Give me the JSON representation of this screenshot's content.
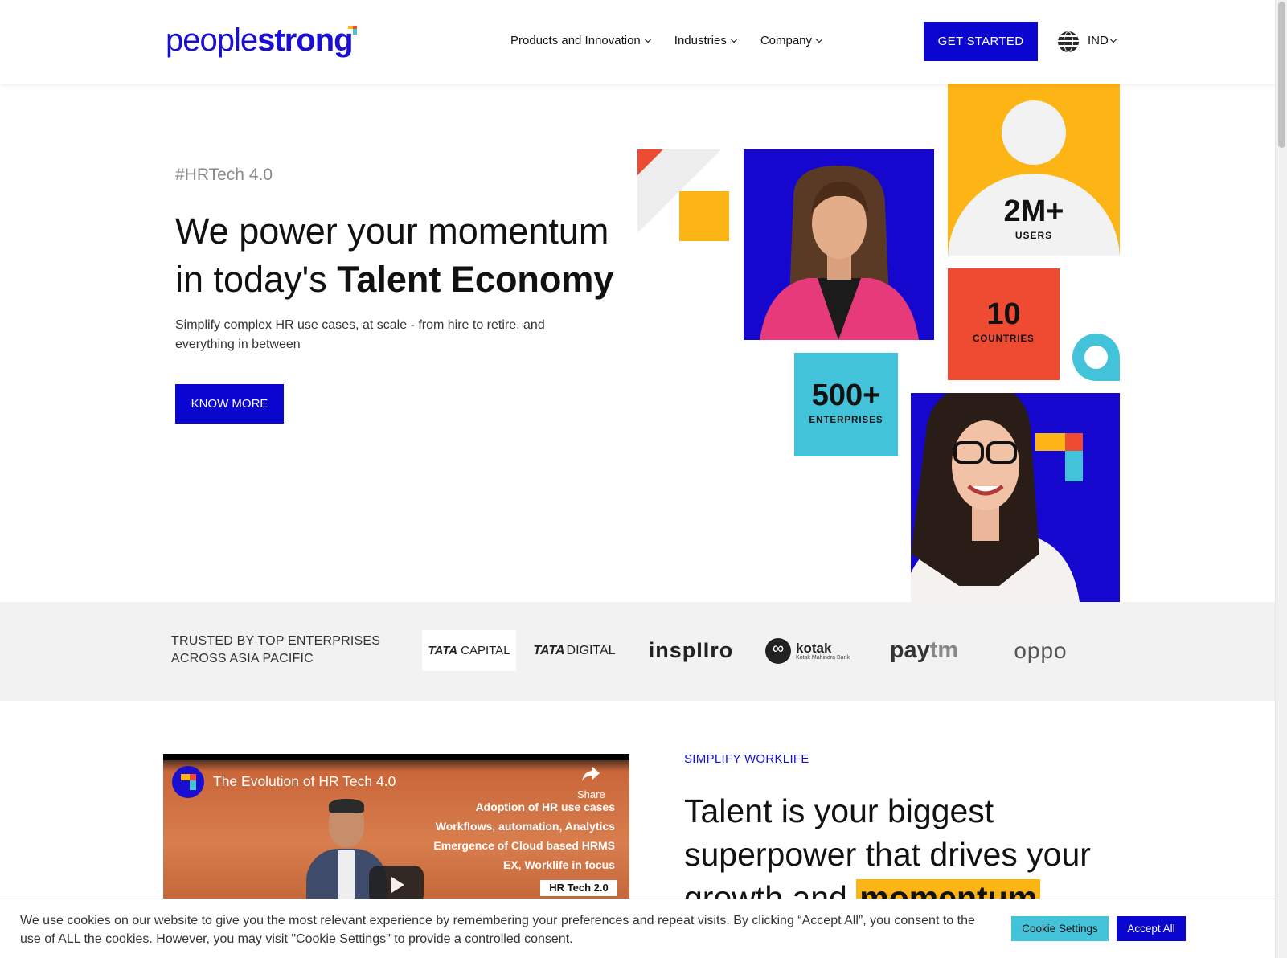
{
  "brand": {
    "logo_part1": "people",
    "logo_part2": "strong"
  },
  "nav": {
    "items": [
      {
        "label": "Products and Innovation"
      },
      {
        "label": "Industries"
      },
      {
        "label": "Company"
      }
    ],
    "cta": "GET STARTED",
    "region": "IND"
  },
  "hero": {
    "tag": "#HRTech 4.0",
    "headline_line1": "We power your momentum",
    "headline_line2_prefix": "in today's ",
    "headline_line2_bold": "Talent Economy",
    "subtext": "Simplify complex HR use cases, at scale - from hire to retire, and everything in between",
    "button": "KNOW MORE"
  },
  "stats": {
    "users": {
      "value": "2M+",
      "label": "USERS"
    },
    "countries": {
      "value": "10",
      "label": "COUNTRIES"
    },
    "enterprises": {
      "value": "500+",
      "label": "ENTERPRISES"
    }
  },
  "trusted": {
    "label_line1": "TRUSTED BY TOP ENTERPRISES",
    "label_line2": "ACROSS ASIA PACIFIC",
    "logos": [
      {
        "part1": "TATA",
        "part2": "CAPITAL"
      },
      {
        "part1": "TATA",
        "part2": "DIGITAL"
      },
      {
        "part1": "inspIIro"
      },
      {
        "part1": "kotak",
        "part2": "Kotak Mahindra Bank"
      },
      {
        "part1": "pay",
        "part2": "tm"
      },
      {
        "part1": "oppo"
      }
    ]
  },
  "video": {
    "title": "The Evolution of HR Tech 4.0",
    "share": "Share",
    "lines": [
      "Adoption of HR use cases",
      "Workflows, automation, Analytics",
      "Emergence of Cloud based HRMS",
      "EX, Worklife in focus"
    ],
    "badge": "HR Tech 2.0"
  },
  "section2": {
    "eyebrow": "SIMPLIFY WORKLIFE",
    "heading_line1": "Talent is your biggest",
    "heading_line2": "superpower that drives your",
    "heading_line3_prefix": "growth and ",
    "heading_highlight": "momentum"
  },
  "cookie": {
    "text": "We use cookies on our website to give you the most relevant experience by remembering your preferences and repeat visits. By clicking “Accept All”, you consent to the use of ALL the cookies. However, you may visit \"Cookie Settings\" to provide a controlled consent.",
    "settings": "Cookie Settings",
    "accept": "Accept All"
  },
  "colors": {
    "brand_blue": "#0a06cf",
    "yellow": "#fdb515",
    "red": "#ef4b32",
    "teal": "#42c3d9"
  }
}
